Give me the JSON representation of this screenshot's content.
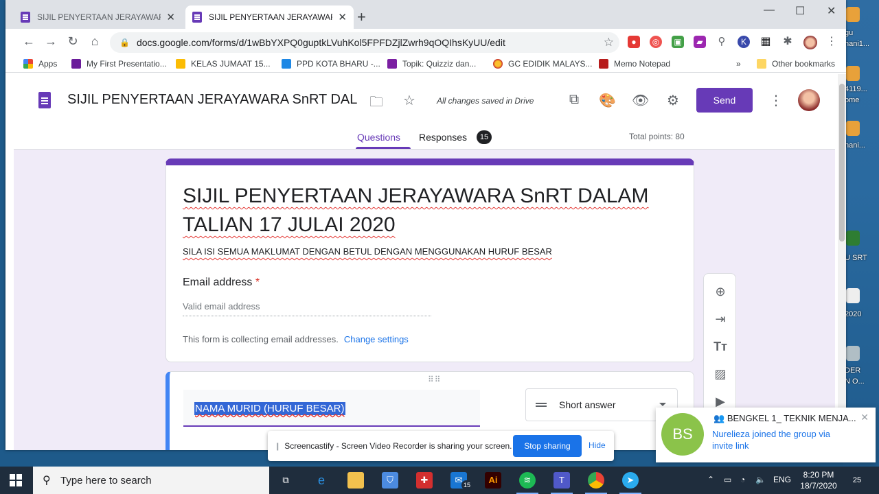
{
  "browser": {
    "tabs": [
      {
        "title": "SIJIL PENYERTAAN JERAYAWARA"
      },
      {
        "title": "SIJIL PENYERTAAN JERAYAWARA"
      }
    ],
    "url": "docs.google.com/forms/d/1wBbYXPQ0guptkLVuhKol5FPFDZjlZwrh9qOQIhsKyUU/edit",
    "bookmarks": [
      {
        "label": "Apps"
      },
      {
        "label": "My First Presentatio..."
      },
      {
        "label": "KELAS JUMAAT 15..."
      },
      {
        "label": "PPD KOTA BHARU -..."
      },
      {
        "label": "Topik: Quizziz dan..."
      },
      {
        "label": "GC EDIDIK MALAYS..."
      },
      {
        "label": "Memo Notepad"
      }
    ],
    "overflow": "»",
    "other_bookmarks": "Other bookmarks"
  },
  "form_header": {
    "doc_title": "SIJIL PENYERTAAN JERAYAWARA SnRT DAL",
    "saved_status": "All changes saved in Drive",
    "send_label": "Send",
    "tabs": {
      "questions": "Questions",
      "responses": "Responses",
      "responses_count": "15"
    },
    "total_points": "Total points: 80"
  },
  "form": {
    "title": "SIJIL PENYERTAAN JERAYAWARA SnRT DALAM TALIAN  17 JULAI 2020",
    "description": "SILA ISI SEMUA MAKLUMAT DENGAN BETUL DENGAN MENGGUNAKAN HURUF BESAR",
    "email_label": "Email address",
    "required_mark": "*",
    "email_placeholder": "Valid email address",
    "collecting_text": "This form is collecting email addresses.",
    "change_settings": "Change settings"
  },
  "question": {
    "title": "NAMA MURID (HURUF BESAR)",
    "type": "Short answer"
  },
  "screencastify": {
    "message": "Screencastify - Screen Video Recorder is sharing your screen.",
    "stop_label": "Stop sharing",
    "hide_label": "Hide"
  },
  "notification": {
    "initials": "BS",
    "title": "BENGKEL 1_ TEKNIK MENJA...",
    "message": "Nurelieza joined the group via invite link"
  },
  "taskbar": {
    "search_placeholder": "Type here to search",
    "mail_badge": "15",
    "lang": "ENG",
    "time": "8:20 PM",
    "date": "18/7/2020",
    "notif_count": "25"
  },
  "desktop_labels": [
    "gu",
    "hani1...",
    "4119...",
    "ome",
    "hani...",
    "U SRT",
    "2020",
    "DER",
    "N O..."
  ],
  "colors": {
    "forms_purple": "#673ab7",
    "accent_blue": "#1a73e8",
    "question_border": "#4285f4"
  }
}
